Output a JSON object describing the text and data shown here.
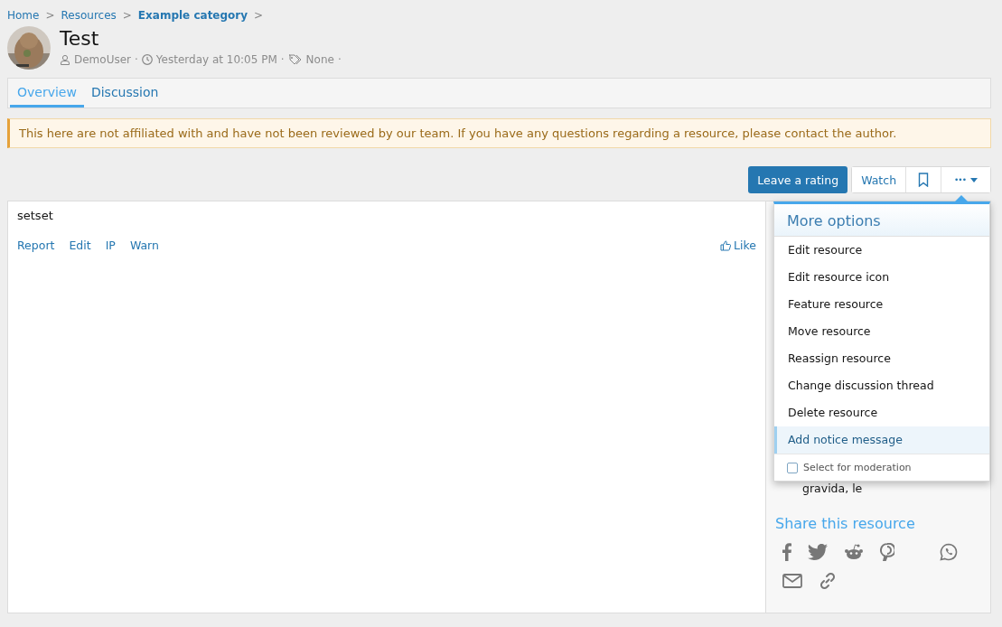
{
  "breadcrumb": [
    {
      "label": "Home",
      "current": false
    },
    {
      "label": "Resources",
      "current": false
    },
    {
      "label": "Example category",
      "current": true
    }
  ],
  "breadcrumb_separator": ">",
  "meta_separator": "·",
  "resource": {
    "title": "Test",
    "author": "DemoUser",
    "time": "Yesterday at 10:05 PM",
    "tags": "None"
  },
  "tabs": [
    {
      "label": "Overview",
      "selected": true
    },
    {
      "label": "Discussion",
      "selected": false
    }
  ],
  "notice": "This here are not affiliated with and have not been reviewed by our team. If you have any questions regarding a resource, please contact the author.",
  "actions": {
    "rate": "Leave a rating",
    "watch": "Watch",
    "more": "•••"
  },
  "post": {
    "body": "setset",
    "links": [
      "Report",
      "Edit",
      "IP",
      "Warn"
    ],
    "like": "Like"
  },
  "sidebar": {
    "snippet": "gravida, le",
    "share_title": "Share this resource"
  },
  "menu": {
    "title": "More options",
    "items": [
      {
        "label": "Edit resource",
        "selected": false
      },
      {
        "label": "Edit resource icon",
        "selected": false
      },
      {
        "label": "Feature resource",
        "selected": false
      },
      {
        "label": "Move resource",
        "selected": false
      },
      {
        "label": "Reassign resource",
        "selected": false
      },
      {
        "label": "Change discussion thread",
        "selected": false
      },
      {
        "label": "Delete resource",
        "selected": false
      },
      {
        "label": "Add notice message",
        "selected": true
      }
    ],
    "moderation": {
      "label": "Select for moderation",
      "checked": false
    }
  }
}
